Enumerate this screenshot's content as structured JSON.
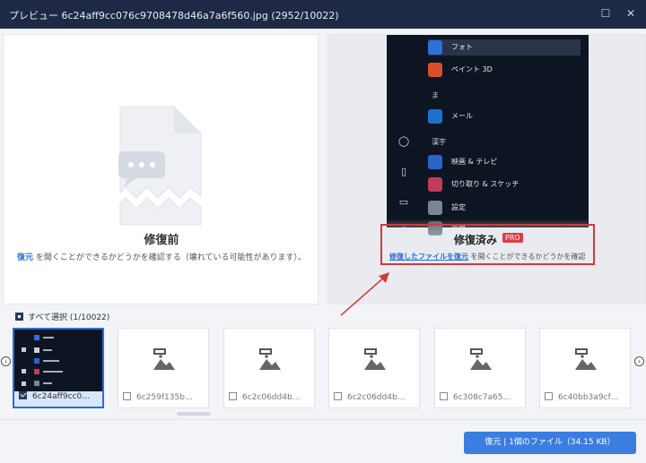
{
  "window": {
    "title": "プレビュー 6c24aff9cc076c9708478d46a7a6f560.jpg (2952/10022)",
    "maximize_glyph": "☐",
    "close_glyph": "✕"
  },
  "before_panel": {
    "label": "修復前",
    "desc_link": "復元",
    "desc_text": " を開くことができるかどうかを確認する（壊れている可能性があります）。"
  },
  "after_panel": {
    "label": "修復済み",
    "pro_badge": "PRO",
    "desc_link": "修復したファイルを復元",
    "desc_text": " を開くことができるかどうかを確認",
    "preview_menu": [
      {
        "label": "フォト",
        "color": "#2f6fd8",
        "selected": true
      },
      {
        "label": "ペイント 3D",
        "color": "#d94f2b",
        "selected": false
      },
      {
        "label": "メール",
        "color": "#1f6fce",
        "selected": false
      },
      {
        "label": "映画 & テレビ",
        "color": "#2a63c9",
        "selected": false
      },
      {
        "label": "切り取り & スケッチ",
        "color": "#c23b58",
        "selected": false
      },
      {
        "label": "設定",
        "color": "#7c8594",
        "selected": false
      },
      {
        "label": "電卓",
        "color": "#556070",
        "selected": false
      }
    ],
    "preview_letters": [
      "ま",
      "漢字"
    ],
    "preview_side_icons": [
      "user-icon",
      "document-icon",
      "image-icon",
      "settings-icon"
    ]
  },
  "file_list": {
    "select_all_label": "すべて選択 (1/10022)",
    "items": [
      {
        "name": "6c24aff9cc0…",
        "checked": true,
        "active": true
      },
      {
        "name": "6c259f135b…",
        "checked": false,
        "active": false
      },
      {
        "name": "6c2c06dd4b…",
        "checked": false,
        "active": false
      },
      {
        "name": "6c2c06dd4b…",
        "checked": false,
        "active": false
      },
      {
        "name": "6c308c7a65…",
        "checked": false,
        "active": false
      },
      {
        "name": "6c40bb3a9cf…",
        "checked": false,
        "active": false
      }
    ],
    "prev_glyph": "‹",
    "next_glyph": "›"
  },
  "actions": {
    "recover_button": "復元 | 1個のファイル（34.15 KB）"
  },
  "colors": {
    "titlebar": "#1e2a45",
    "accent": "#3b7de0",
    "highlight_box": "#d33a3a",
    "pro_badge": "#e03a4a"
  }
}
